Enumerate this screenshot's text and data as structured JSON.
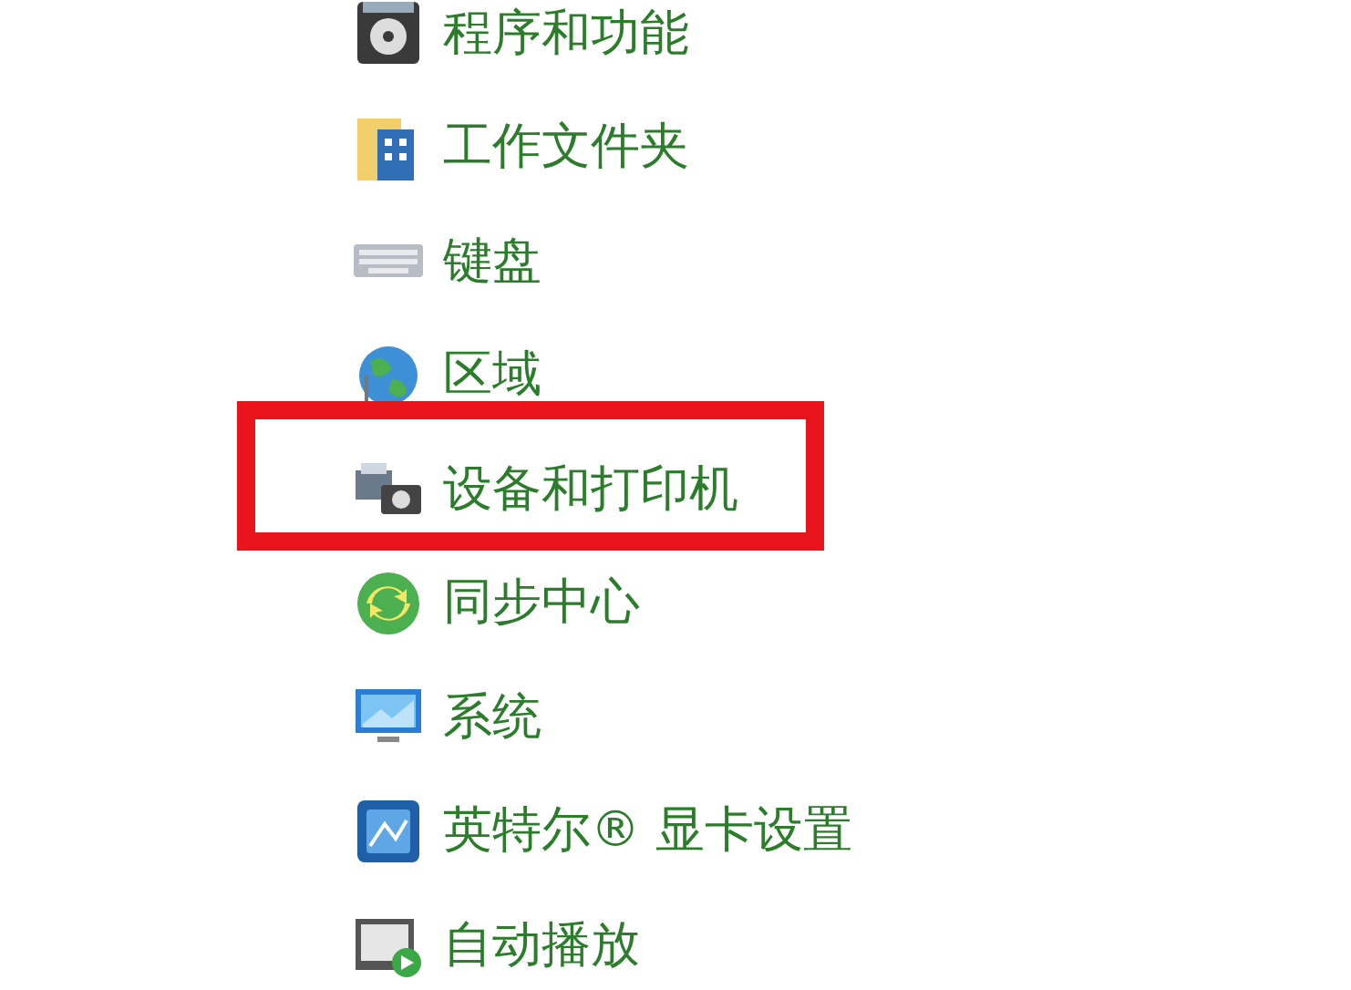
{
  "items": [
    {
      "kind": "programs",
      "label": "程序和功能",
      "highlighted": false
    },
    {
      "kind": "folder",
      "label": "工作文件夹",
      "highlighted": false
    },
    {
      "kind": "keyboard",
      "label": "键盘",
      "highlighted": false
    },
    {
      "kind": "region",
      "label": "区域",
      "highlighted": false
    },
    {
      "kind": "devices",
      "label": "设备和打印机",
      "highlighted": true
    },
    {
      "kind": "sync",
      "label": "同步中心",
      "highlighted": false
    },
    {
      "kind": "system",
      "label": "系统",
      "highlighted": false
    },
    {
      "kind": "graphics",
      "label": "英特尔® 显卡设置",
      "highlighted": false
    },
    {
      "kind": "autoplay",
      "label": "自动播放",
      "highlighted": false
    }
  ]
}
